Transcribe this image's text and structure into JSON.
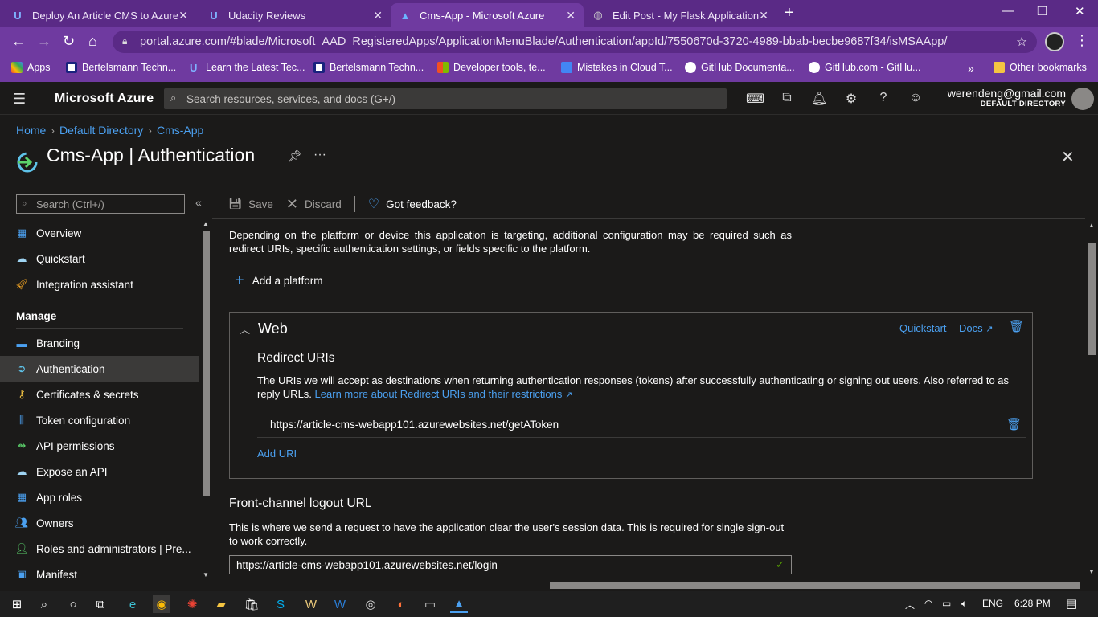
{
  "browser": {
    "tabs": [
      {
        "title": "Deploy An Article CMS to Azure",
        "x": 0
      },
      {
        "title": "Udacity Reviews",
        "x": 0
      },
      {
        "title": "Cms-App - Microsoft Azure",
        "x": 0
      },
      {
        "title": "Edit Post - My Flask Application",
        "x": 0
      }
    ],
    "url": "portal.azure.com/#blade/Microsoft_AAD_RegisteredApps/ApplicationMenuBlade/Authentication/appId/7550670d-3720-4989-bbab-becbe9687f34/isMSAApp/",
    "bookmarks": [
      "Apps",
      "Bertelsmann Techn...",
      "Learn the Latest Tec...",
      "Bertelsmann Techn...",
      "Developer tools, te...",
      "Mistakes in Cloud T...",
      "GitHub Documenta...",
      "GitHub.com - GitHu..."
    ],
    "overflow": "»",
    "other_bookmarks": "Other bookmarks"
  },
  "azure": {
    "brand": "Microsoft Azure",
    "search_placeholder": "Search resources, services, and docs (G+/)",
    "user_email": "werendeng@gmail.com",
    "user_directory": "DEFAULT DIRECTORY"
  },
  "breadcrumb": [
    "Home",
    "Default Directory",
    "Cms-App"
  ],
  "page_title": "Cms-App | Authentication",
  "sidebar": {
    "search_placeholder": "Search (Ctrl+/)",
    "items_top": [
      "Overview",
      "Quickstart",
      "Integration assistant"
    ],
    "manage_heading": "Manage",
    "items_manage": [
      "Branding",
      "Authentication",
      "Certificates & secrets",
      "Token configuration",
      "API permissions",
      "Expose an API",
      "App roles",
      "Owners",
      "Roles and administrators | Pre...",
      "Manifest"
    ]
  },
  "toolbar": {
    "save": "Save",
    "discard": "Discard",
    "feedback": "Got feedback?"
  },
  "content": {
    "description": "Depending on the platform or device this application is targeting, additional configuration may be required such as redirect URIs, specific authentication settings, or fields specific to the platform.",
    "add_platform": "Add a platform",
    "web": {
      "title": "Web",
      "quickstart": "Quickstart",
      "docs": "Docs",
      "redirect_title": "Redirect URIs",
      "redirect_desc": "The URIs we will accept as destinations when returning authentication responses (tokens) after successfully authenticating or signing out users. Also referred to as reply URLs.",
      "redirect_link": "Learn more about Redirect URIs and their restrictions",
      "uri": "https://article-cms-webapp101.azurewebsites.net/getAToken",
      "add_uri": "Add URI"
    },
    "front_channel": {
      "title": "Front-channel logout URL",
      "desc": "This is where we send a request to have the application clear the user's session data. This is required for single sign-out to work correctly.",
      "value": "https://article-cms-webapp101.azurewebsites.net/login"
    }
  },
  "taskbar": {
    "lang": "ENG",
    "time": "6:28 PM"
  }
}
